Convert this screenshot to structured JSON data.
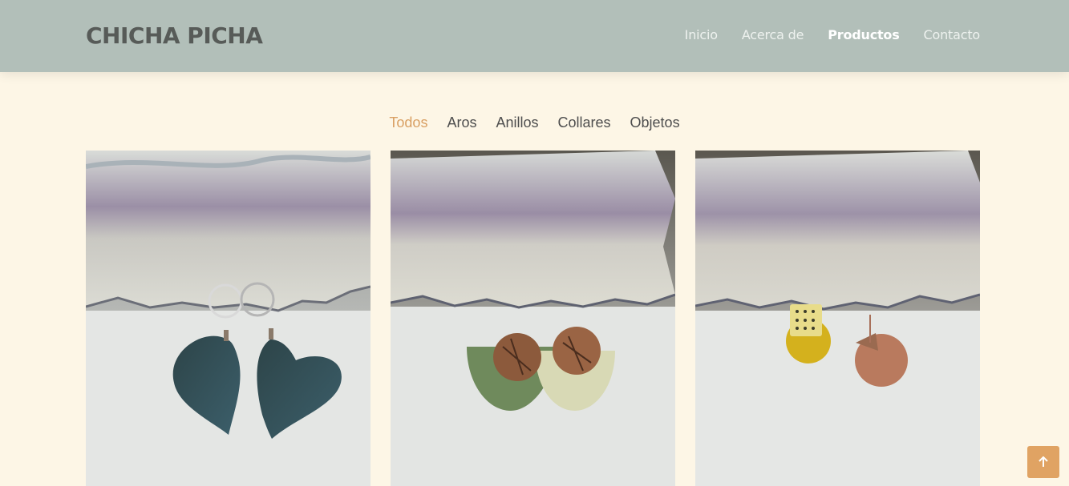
{
  "header": {
    "brand": "CHICHA PICHA",
    "nav": [
      {
        "label": "Inicio",
        "active": false
      },
      {
        "label": "Acerca de",
        "active": false
      },
      {
        "label": "Productos",
        "active": true
      },
      {
        "label": "Contacto",
        "active": false
      }
    ]
  },
  "filters": [
    {
      "label": "Todos",
      "active": true
    },
    {
      "label": "Aros",
      "active": false
    },
    {
      "label": "Anillos",
      "active": false
    },
    {
      "label": "Collares",
      "active": false
    },
    {
      "label": "Objetos",
      "active": false
    }
  ],
  "products": [
    {
      "image": "earrings-blue-hearts-photo"
    },
    {
      "image": "earrings-copper-half-moon-photo"
    },
    {
      "image": "earrings-yellow-copper-photo"
    }
  ],
  "back_to_top": {
    "icon": "arrow-up-icon"
  },
  "colors": {
    "header_bg": "#b2bfb9",
    "page_bg": "#fdf6e6",
    "accent": "#d9a064",
    "brand_text": "#575b58"
  }
}
